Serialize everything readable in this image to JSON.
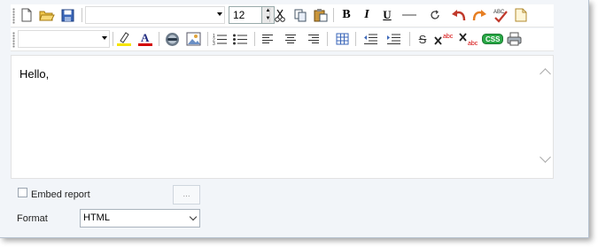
{
  "editor": {
    "body_text": "Hello,",
    "font_size": "12"
  },
  "toolbar1": {
    "icons": [
      "new-document-icon",
      "open-folder-icon",
      "save-disk-icon",
      "cut-icon",
      "copy-icon",
      "paste-icon",
      "bold-icon",
      "italic-icon",
      "underline-icon",
      "horizontal-rule-icon",
      "refresh-icon",
      "undo-icon",
      "redo-icon",
      "spellcheck-icon",
      "page-icon"
    ],
    "bold": "B",
    "italic": "I",
    "underline": "U"
  },
  "toolbar2": {
    "icons": [
      "highlight-pen-icon",
      "font-color-icon",
      "link-icon",
      "image-icon",
      "numbered-list-icon",
      "bulleted-list-icon",
      "align-left-icon",
      "align-center-icon",
      "align-right-icon",
      "table-icon",
      "outdent-icon",
      "indent-icon",
      "strikethrough-icon",
      "superscript-icon",
      "subscript-icon",
      "css-icon",
      "print-icon"
    ],
    "font_color_letter": "A",
    "strike_letter": "S",
    "sup_text": "abc",
    "sub_text": "abc",
    "css_label": "CSS"
  },
  "options": {
    "embed_report_label": "Embed report",
    "embed_report_checked": false,
    "ellipsis_label": "...",
    "format_label": "Format",
    "format_value": "HTML"
  },
  "colors": {
    "highlight": "#f5e400",
    "font_color": "#d40000",
    "bold_red": "#c0392b",
    "css_green": "#28a745"
  }
}
